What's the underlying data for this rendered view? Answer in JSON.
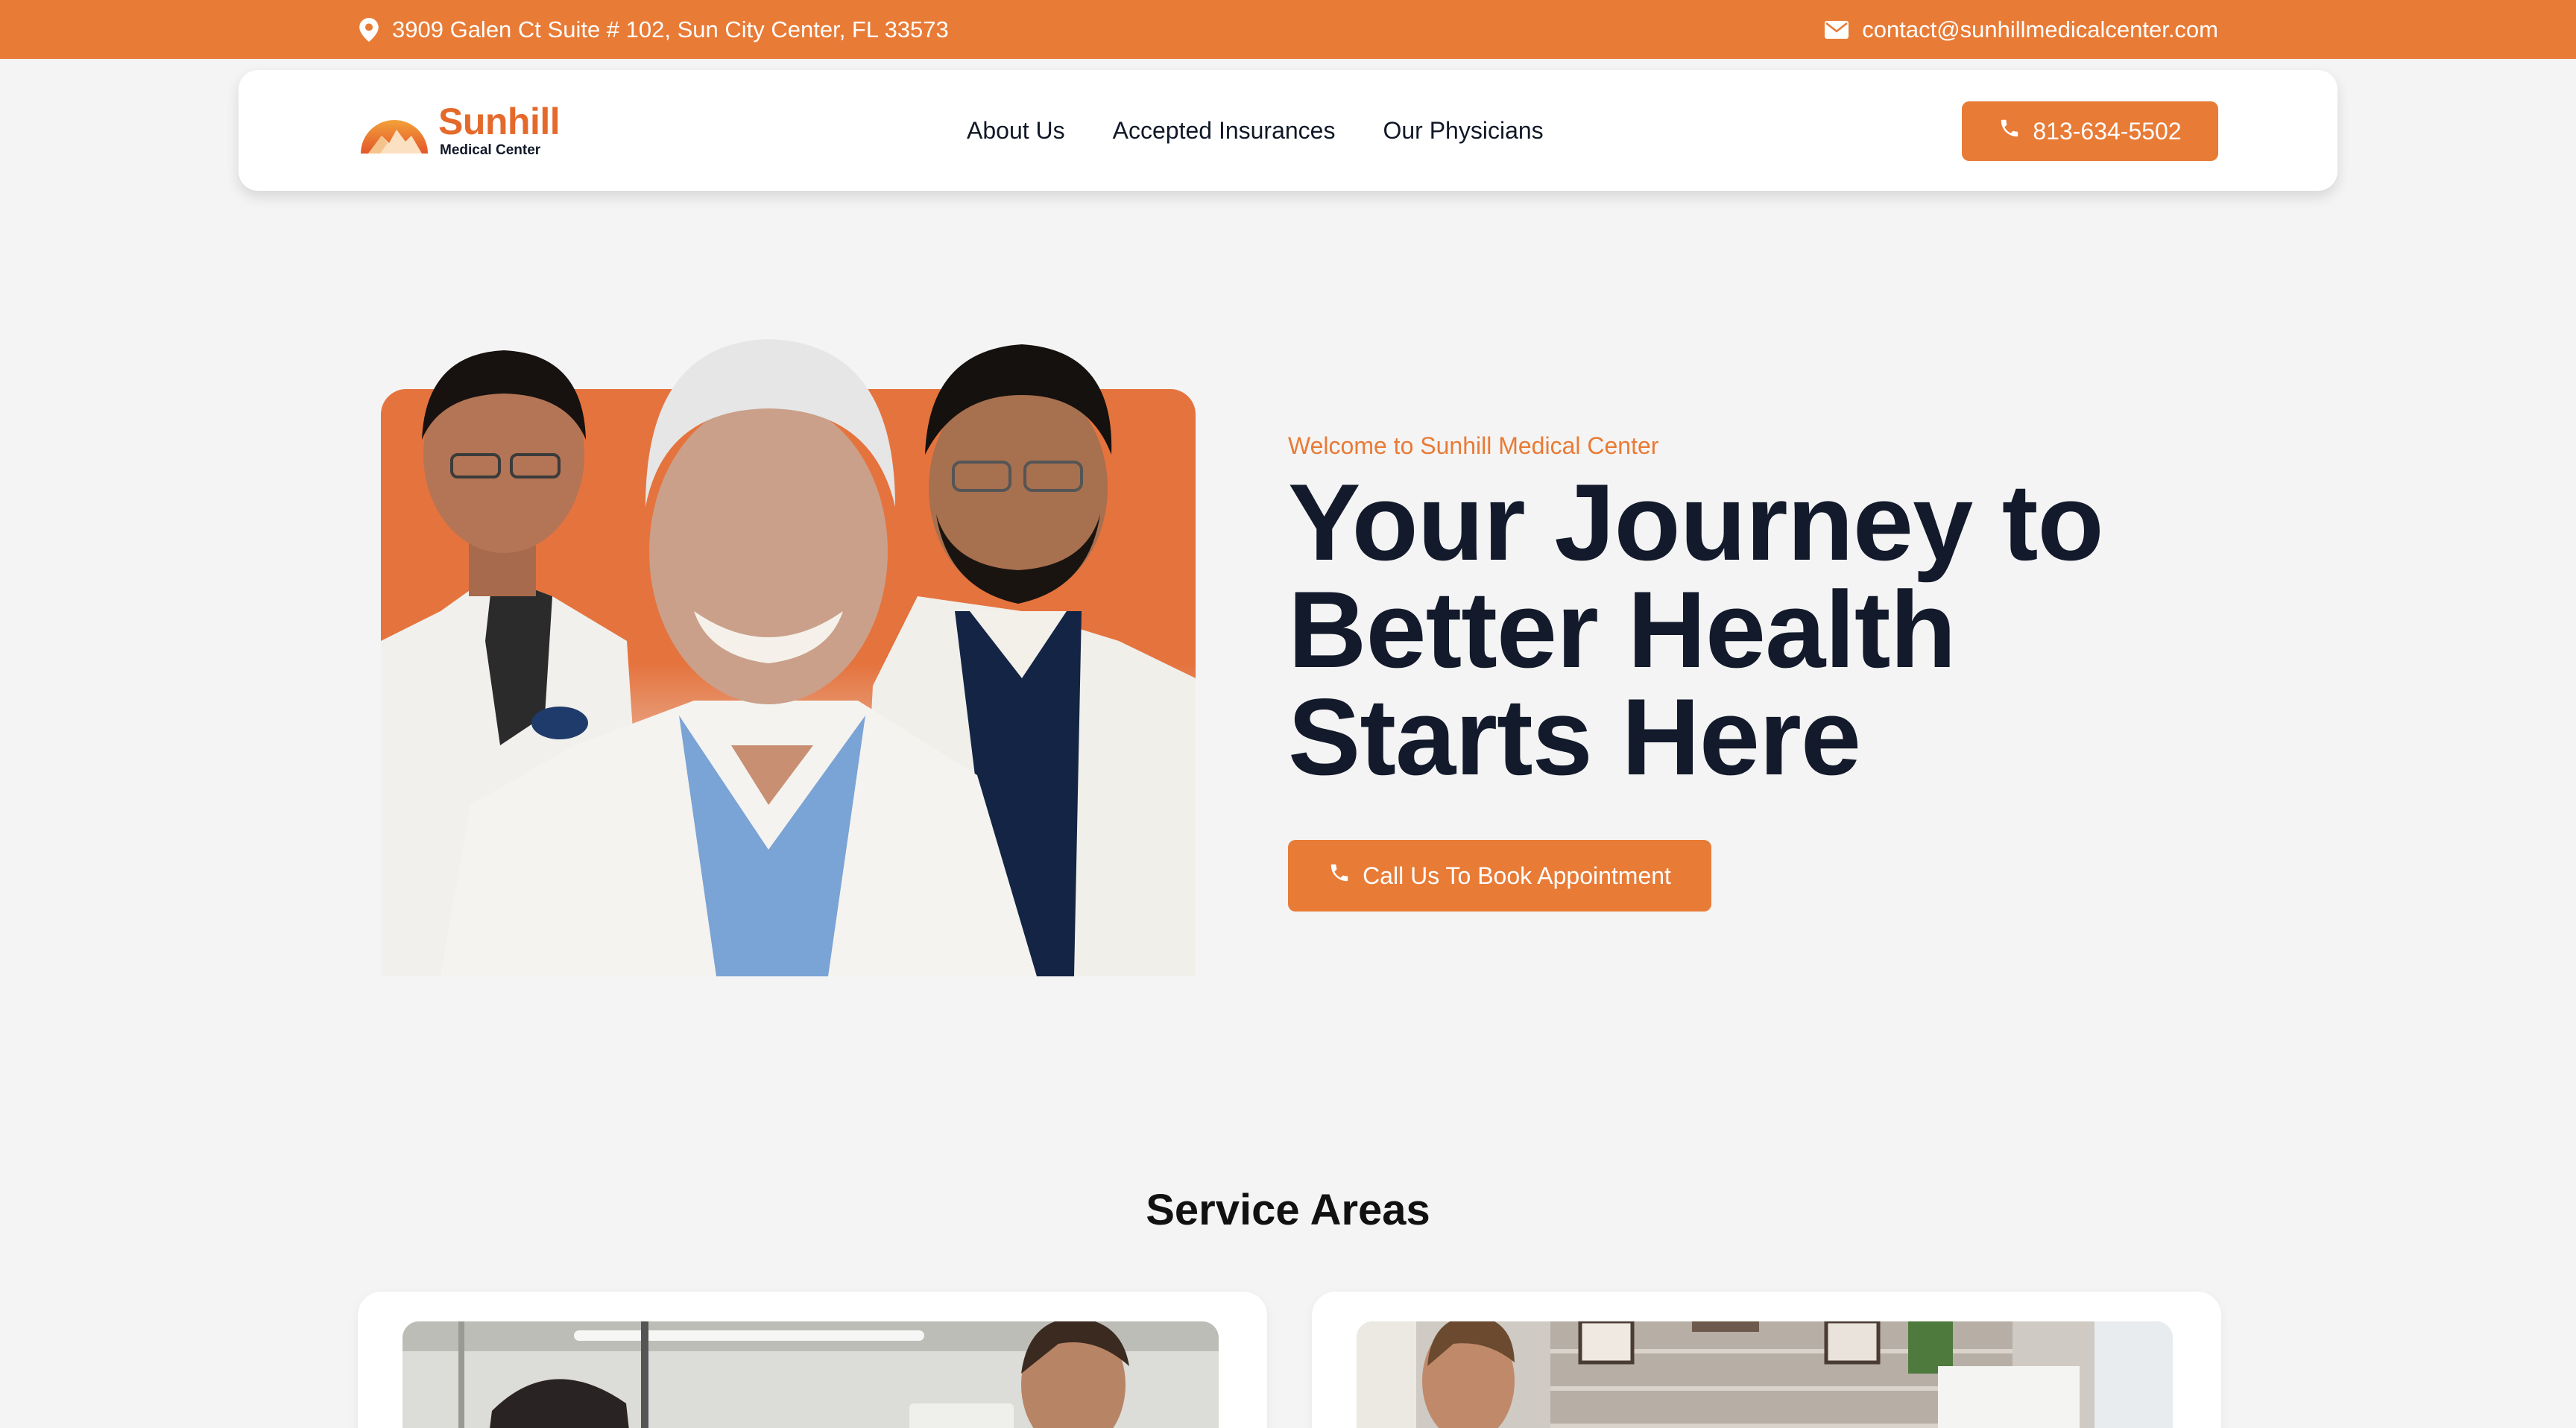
{
  "topbar": {
    "address": "3909 Galen Ct Suite # 102, Sun City Center, FL 33573",
    "email": "contact@sunhillmedicalcenter.com",
    "address_icon": "map-pin-icon",
    "email_icon": "envelope-icon"
  },
  "header": {
    "logo_brand": "Sunhill",
    "logo_sub": "Medical Center",
    "nav": [
      "About Us",
      "Accepted Insurances",
      "Our Physicians"
    ],
    "phone": "813-634-5502",
    "phone_icon": "phone-icon"
  },
  "hero": {
    "welcome": "Welcome to Sunhill Medical Center",
    "headline_line1": "Your Journey to",
    "headline_line2": "Better Health",
    "headline_line3": "Starts Here",
    "cta_label": "Call Us To Book Appointment"
  },
  "services": {
    "title": "Service Areas"
  },
  "colors": {
    "accent": "#e87b36",
    "headline": "#131a2b",
    "background": "#f4f4f4"
  }
}
